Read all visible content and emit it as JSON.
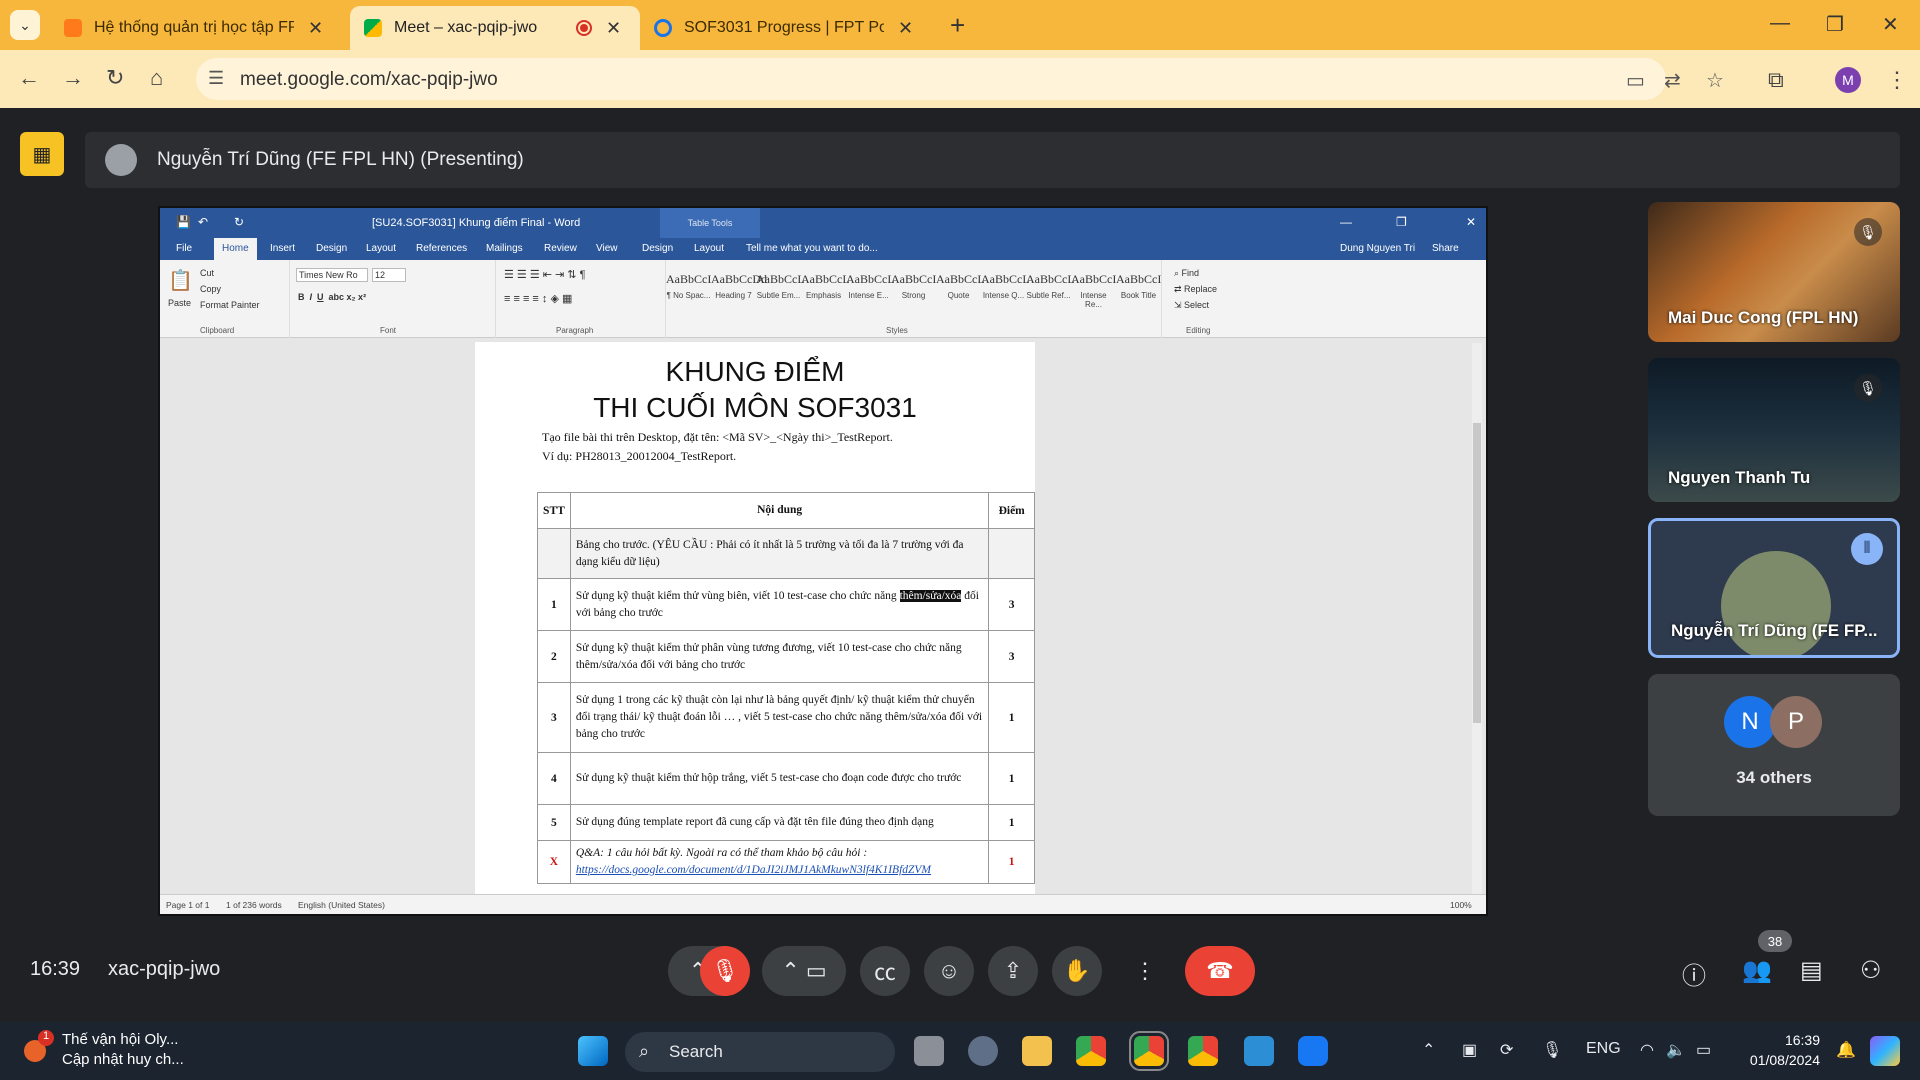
{
  "browser": {
    "tabs": [
      {
        "title": "Hệ thống quản trị học tập FPT P"
      },
      {
        "title": "Meet – xac-pqip-jwo"
      },
      {
        "title": "SOF3031 Progress | FPT Polytec"
      }
    ],
    "url": "meet.google.com/xac-pqip-jwo",
    "profile_initial": "M"
  },
  "meet": {
    "presenter_label": "Nguyễn Trí Dũng (FE FPL HN) (Presenting)",
    "time": "16:39",
    "meeting_code": "xac-pqip-jwo",
    "participants_count": "38",
    "tiles": [
      {
        "name": "Mai Duc Cong (FPL HN)"
      },
      {
        "name": "Nguyen Thanh Tu"
      },
      {
        "name": "Nguyễn Trí Dũng (FE FP..."
      },
      {
        "initials": [
          "N",
          "P"
        ],
        "name": "34 others"
      }
    ]
  },
  "word": {
    "title": "[SU24.SOF3031] Khung điểm Final - Word",
    "table_tools": "Table Tools",
    "user": "Dung Nguyen Tri",
    "share": "Share",
    "menu": [
      "File",
      "Home",
      "Insert",
      "Design",
      "Layout",
      "References",
      "Mailings",
      "Review",
      "View",
      "Design",
      "Layout"
    ],
    "tell_me": "Tell me what you want to do...",
    "clipboard": {
      "paste": "Paste",
      "cut": "Cut",
      "copy": "Copy",
      "format_painter": "Format Painter",
      "label": "Clipboard"
    },
    "font": {
      "name": "Times New Ro",
      "size": "12",
      "label": "Font"
    },
    "paragraph_label": "Paragraph",
    "styles_label": "Styles",
    "styles": [
      {
        "preview": "AaBbCcI",
        "name": "¶ No Spac..."
      },
      {
        "preview": "AaBbCcDd",
        "name": "Heading 7"
      },
      {
        "preview": "AaBbCcL",
        "name": "Subtle Em..."
      },
      {
        "preview": "AaBbCcL",
        "name": "Emphasis"
      },
      {
        "preview": "AaBbCcL",
        "name": "Intense E..."
      },
      {
        "preview": "AaBbCcI",
        "name": "Strong"
      },
      {
        "preview": "AaBbCcL",
        "name": "Quote"
      },
      {
        "preview": "AaBbCcL",
        "name": "Intense Q..."
      },
      {
        "preview": "AaBbCcL",
        "name": "Subtle Ref..."
      },
      {
        "preview": "AaBbCcI",
        "name": "Intense Re..."
      },
      {
        "preview": "AaBbCcI",
        "name": "Book Title"
      }
    ],
    "editing": {
      "find": "Find",
      "replace": "Replace",
      "select": "Select",
      "label": "Editing"
    },
    "doc": {
      "title1": "KHUNG ĐIỂM",
      "title2": "THI CUỐI MÔN SOF3031",
      "line1": "Tạo file bài thi trên Desktop, đặt tên: <Mã SV>_<Ngày thi>_TestReport.",
      "line2": "Ví dụ: PH28013_20012004_TestReport.",
      "headers": [
        "STT",
        "Nội dung",
        "Điểm"
      ],
      "rows": [
        {
          "stt": "",
          "content": "Bảng cho trước. (YÊU CẦU : Phải có ít nhất là 5 trường và tối đa là 7 trường với đa dạng kiểu dữ liệu)",
          "score": ""
        },
        {
          "stt": "1",
          "content_a": "Sử dụng kỹ thuật kiểm thử vùng biên, viết 10 test-case cho chức năng ",
          "content_sel": "thêm/sửa/xóa",
          "content_b": " đối với bảng cho trước",
          "score": "3"
        },
        {
          "stt": "2",
          "content": "Sử dụng kỹ thuật kiểm thử phân vùng tương đương, viết 10 test-case cho chức năng thêm/sửa/xóa đối với bảng cho trước",
          "score": "3"
        },
        {
          "stt": "3",
          "content": "Sử dụng 1 trong các kỹ thuật còn lại như là bảng quyết định/ kỹ thuật kiểm thử chuyển đổi trạng thái/ kỹ thuật đoán lỗi … , viết 5 test-case cho chức năng thêm/sửa/xóa đối với bảng cho trước",
          "score": "1"
        },
        {
          "stt": "4",
          "content": "Sử dụng kỹ thuật kiểm thử hộp trắng, viết 5 test-case cho đoạn code được cho trước",
          "score": "1"
        },
        {
          "stt": "5",
          "content": "Sử dụng đúng template report đã cung cấp và đặt tên file đúng theo định dạng",
          "score": "1"
        },
        {
          "stt": "X",
          "content": "Q&A: 1 câu hỏi bất kỳ. Ngoài ra có thể tham khảo bộ câu hỏi :",
          "link": "https://docs.google.com/document/d/1DaJI2iJMJ1AkMkuwN3lf4K1IBfdZVM",
          "score": "1"
        }
      ]
    },
    "status": {
      "page": "Page 1 of 1",
      "words": "1 of 236 words",
      "lang": "English (United States)",
      "zoom": "100%"
    }
  },
  "taskbar": {
    "news_title": "Thế vận hội Oly...",
    "news_sub": "Cập nhật huy ch...",
    "news_badge": "1",
    "search": "Search",
    "lang": "ENG",
    "time": "16:39",
    "date": "01/08/2024"
  }
}
